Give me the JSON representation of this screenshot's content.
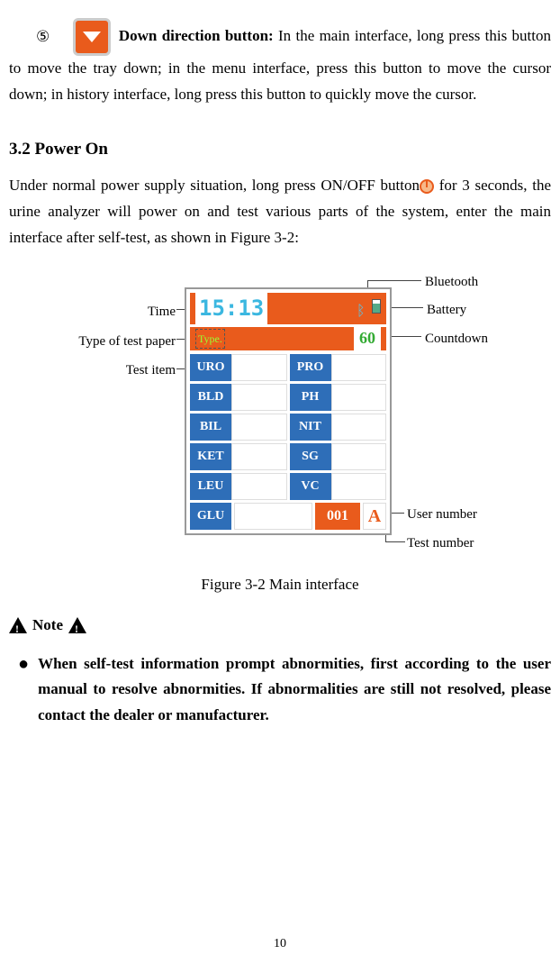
{
  "item5": {
    "number": "⑤",
    "title": "Down direction button:",
    "desc": "In the main interface, long press this button to move the tray down; in the menu interface, press this button to move the cursor down; in history interface, long press this button to quickly move the cursor."
  },
  "section_heading": "3.2 Power On",
  "power_on_para_part1": "Under normal power supply situation, long press ON/OFF button",
  "power_on_para_part2": "for 3 seconds, the urine analyzer will power on and test various parts of the system, enter the main interface after self-test, as shown in Figure 3-2:",
  "callouts": {
    "time": "Time",
    "type": "Type of test paper",
    "testitem": "Test item",
    "bluetooth": "Bluetooth",
    "battery": "Battery",
    "countdown": "Countdown",
    "usernum": "User number",
    "testnum": "Test number"
  },
  "device": {
    "time": "15:13",
    "type_label": "Type.",
    "countdown": "60",
    "grid": [
      [
        "URO",
        "PRO"
      ],
      [
        "BLD",
        "PH"
      ],
      [
        "BIL",
        "NIT"
      ],
      [
        "KET",
        "SG"
      ],
      [
        "LEU",
        "VC"
      ]
    ],
    "last_row": {
      "glu": "GLU",
      "usernum": "001",
      "testnum": "A"
    }
  },
  "fig_caption": "Figure 3-2 Main interface",
  "note_label": "Note",
  "bullet1": "When self-test information prompt abnormities, first according to the user manual to resolve abnormities. If abnormalities are still not resolved, please contact the dealer or manufacturer.",
  "page_number": "10"
}
